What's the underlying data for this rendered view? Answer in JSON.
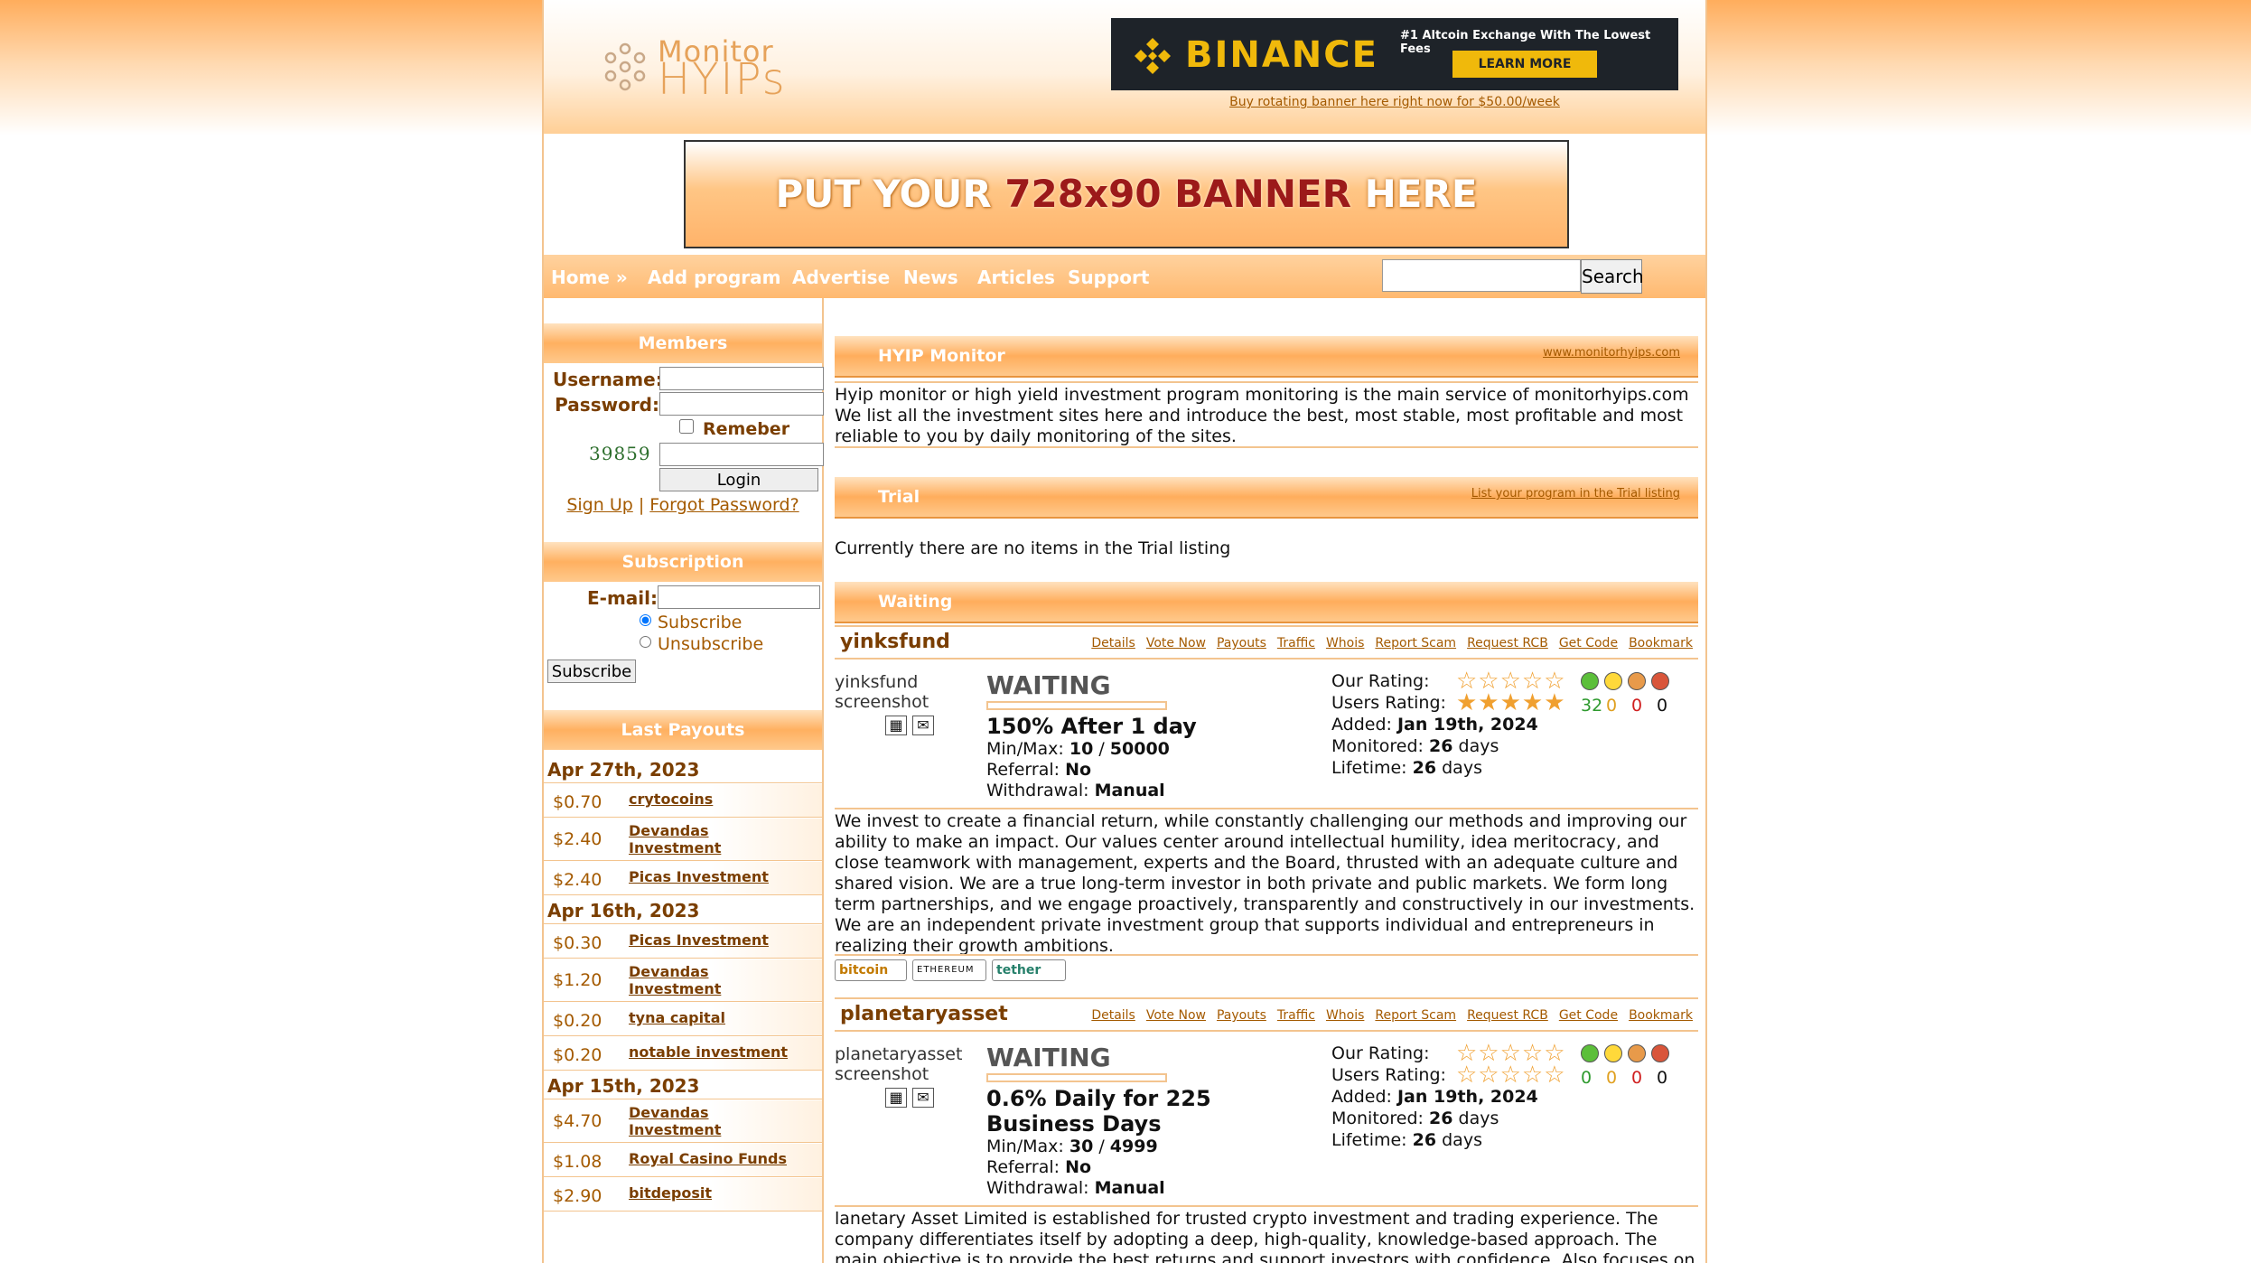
{
  "header": {
    "logo_line1": "Monitor",
    "logo_line2": "HYIPs",
    "ad": {
      "brand": "BINANCE",
      "tagline": "#1 Altcoin Exchange With The Lowest Fees",
      "button": "LEARN MORE"
    },
    "ad_link": "Buy rotating banner here right now for $50.00/week",
    "banner": {
      "part1": "PUT YOUR ",
      "highlight": "728x90 BANNER",
      "part2": " HERE"
    }
  },
  "nav": {
    "items": [
      "Home »",
      "Add program",
      "Advertise",
      "News",
      "Articles",
      "Support"
    ],
    "search_button": "Search"
  },
  "sidebar": {
    "members": {
      "title": "Members",
      "username_label": "Username:",
      "password_label": "Password:",
      "remember_label": "Remeber me",
      "captcha": "39859",
      "login_button": "Login",
      "signup": "Sign Up",
      "sep": "|",
      "forgot": "Forgot Password?"
    },
    "subscription": {
      "title": "Subscription",
      "email_label": "E-mail:",
      "subscribe_radio": "Subscribe",
      "unsubscribe_radio": "Unsubscribe",
      "button": "Subscribe"
    },
    "payouts": {
      "title": "Last Payouts",
      "groups": [
        {
          "date": "Apr 27th, 2023",
          "rows": [
            {
              "amount": "$0.70",
              "name": "crytocoins"
            },
            {
              "amount": "$2.40",
              "name": "Devandas Investment"
            },
            {
              "amount": "$2.40",
              "name": "Picas Investment"
            }
          ]
        },
        {
          "date": "Apr 16th, 2023",
          "rows": [
            {
              "amount": "$0.30",
              "name": "Picas Investment"
            },
            {
              "amount": "$1.20",
              "name": "Devandas Investment"
            },
            {
              "amount": "$0.20",
              "name": "tyna capital"
            },
            {
              "amount": "$0.20",
              "name": "notable investment"
            }
          ]
        },
        {
          "date": "Apr 15th, 2023",
          "rows": [
            {
              "amount": "$4.70",
              "name": "Devandas Investment"
            },
            {
              "amount": "$1.08",
              "name": "Royal Casino Funds"
            },
            {
              "amount": "$2.90",
              "name": "bitdeposit"
            }
          ]
        }
      ]
    }
  },
  "main": {
    "monitor": {
      "title": "HYIP Monitor",
      "link": "www.monitorhyips.com",
      "text": "Hyip monitor or high yield investment program monitoring is the main service of monitorhyips.com We list all the investment sites here and introduce the best, most stable, most profitable and most reliable to you by daily monitoring of the sites."
    },
    "trial": {
      "title": "Trial",
      "link": "List your program in the Trial listing",
      "empty": "Currently there are no items in the Trial listing"
    },
    "waiting": {
      "title": "Waiting",
      "link_labels": [
        "Details",
        "Vote Now",
        "Payouts",
        "Traffic",
        "Whois",
        "Report Scam",
        "Request RCB",
        "Get Code",
        "Bookmark"
      ],
      "labels": {
        "our_rating": "Our Rating:",
        "users_rating": "Users Rating:",
        "added": "Added:",
        "monitored": "Monitored:",
        "lifetime": "Lifetime:",
        "minmax": "Min/Max:",
        "referral": "Referral:",
        "withdrawal": "Withdrawal:",
        "slash": "/"
      },
      "programs": [
        {
          "name": "yinksfund",
          "screenshot_alt": "yinksfund screenshot",
          "status": "WAITING",
          "plan": "150% After 1 day",
          "min": "10",
          "max": "50000",
          "referral": "No",
          "withdrawal": "Manual",
          "added": "Jan 19th, 2024",
          "monitored": "26",
          "lifetime": "26",
          "days": "days",
          "users_stars": 5,
          "votes": [
            "32",
            "0",
            "0",
            "0"
          ],
          "description": "We invest to create a financial return, while constantly challenging our methods and improving our ability to make an impact. Our values center around intellectual humility, idea meritocracy, and close teamwork with management, experts and the Board, thrusted with an adequate culture and shared vision. We are a true long-term investor in both private and public markets. We form long term partnerships, and we engage proactively, transparently and constructively in our investments. We are an independent private investment group that supports individual and entrepreneurs in realizing their growth ambitions.",
          "coins": [
            "bitcoin",
            "ETHEREUM",
            "tether"
          ]
        },
        {
          "name": "planetaryasset",
          "screenshot_alt": "planetaryasset screenshot",
          "status": "WAITING",
          "plan": "0.6% Daily for 225 Business Days",
          "min": "30",
          "max": "4999",
          "referral": "No",
          "withdrawal": "Manual",
          "added": "Jan 19th, 2024",
          "monitored": "26",
          "lifetime": "26",
          "days": "days",
          "users_stars": 0,
          "votes": [
            "0",
            "0",
            "0",
            "0"
          ],
          "description": "lanetary Asset Limited is established for trusted crypto investment and trading experience. The company differentiates itself by adopting a deep, high-quality, knowledge-based approach. The main objective is to provide the best returns and support investors with confidence. Also focuses on"
        }
      ]
    }
  },
  "colors": {
    "accent": "#ffad5c",
    "link": "#a45a00",
    "dark_label": "#7a3e00",
    "binance_yellow": "#f0b90b"
  }
}
